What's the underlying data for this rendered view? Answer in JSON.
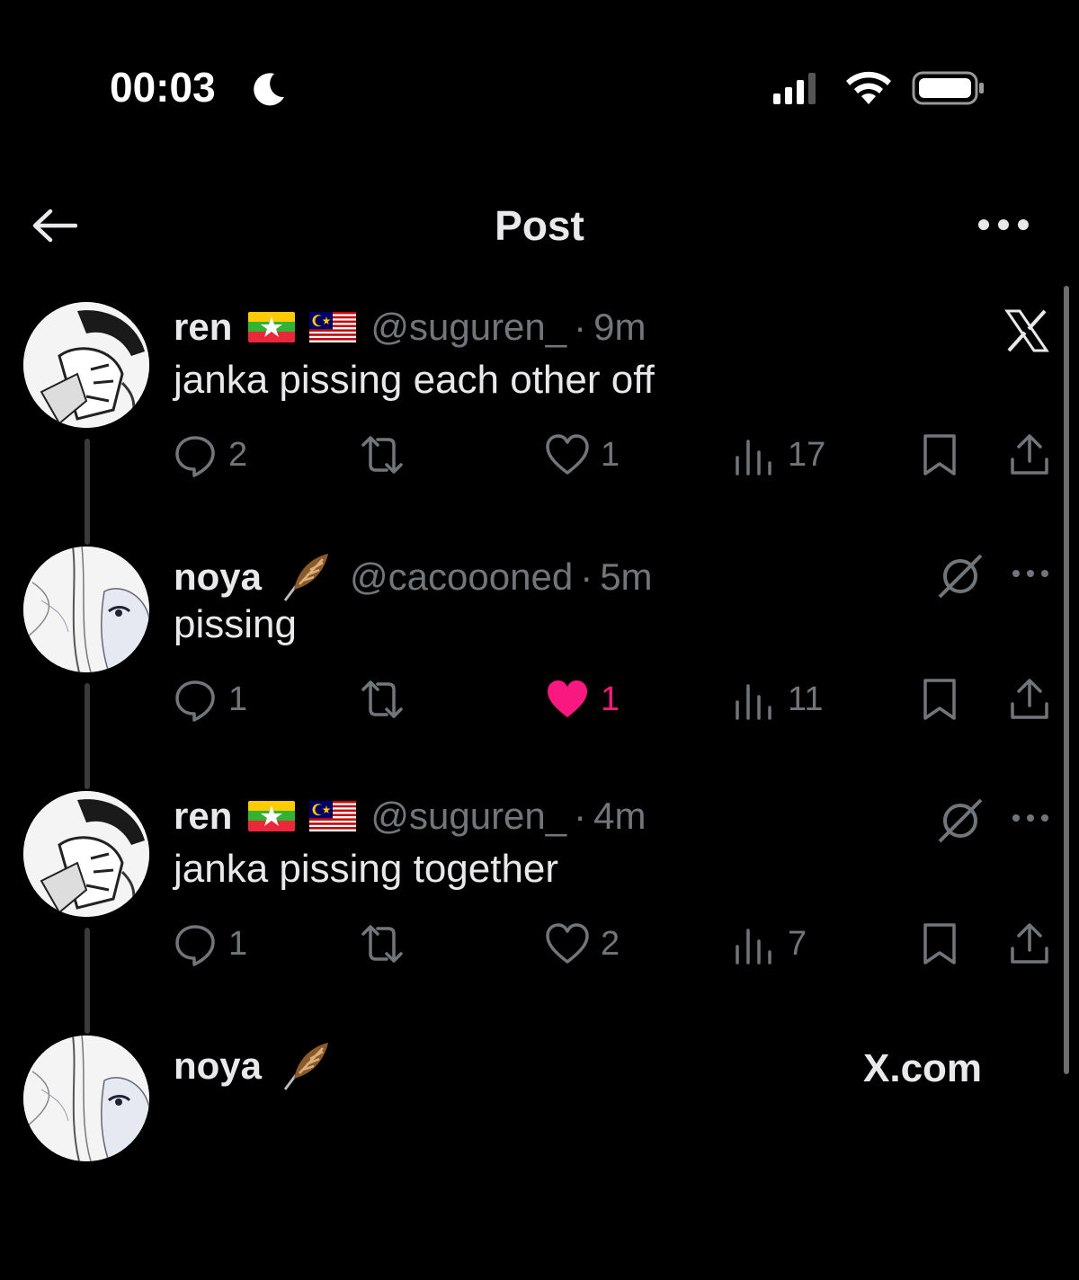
{
  "status_bar": {
    "time": "00:03"
  },
  "header": {
    "title": "Post"
  },
  "posts": [
    {
      "name": "ren",
      "handle": "@suguren_",
      "separator": "·",
      "age": "9m",
      "text": "janka pissing each other off",
      "replies": "2",
      "reposts": "",
      "likes": "1",
      "views": "17",
      "liked": false,
      "flags": [
        "myanmar-flag",
        "malaysia-flag"
      ],
      "top_right": "x-logo-icon"
    },
    {
      "name": "noya",
      "handle": "@cacoooned",
      "separator": "·",
      "age": "5m",
      "text": "pissing",
      "replies": "1",
      "reposts": "",
      "likes": "1",
      "views": "11",
      "liked": true,
      "flags": [
        "feather-emoji"
      ],
      "top_right": "grok-icon"
    },
    {
      "name": "ren",
      "handle": "@suguren_",
      "separator": "·",
      "age": "4m",
      "text": "janka pissing together",
      "replies": "1",
      "reposts": "",
      "likes": "2",
      "views": "7",
      "liked": false,
      "flags": [
        "myanmar-flag",
        "malaysia-flag"
      ],
      "top_right": "grok-icon"
    },
    {
      "name": "noya",
      "handle": "",
      "separator": "",
      "age": "",
      "text": "",
      "replies": "",
      "reposts": "",
      "likes": "",
      "views": "",
      "liked": false,
      "flags": [
        "feather-emoji"
      ],
      "top_right": "x-logo-icon",
      "partial_text": "X.com"
    }
  ],
  "colors": {
    "background": "#000000",
    "text": "#e7e9ea",
    "muted": "#71767b",
    "like_active": "#f91880"
  }
}
